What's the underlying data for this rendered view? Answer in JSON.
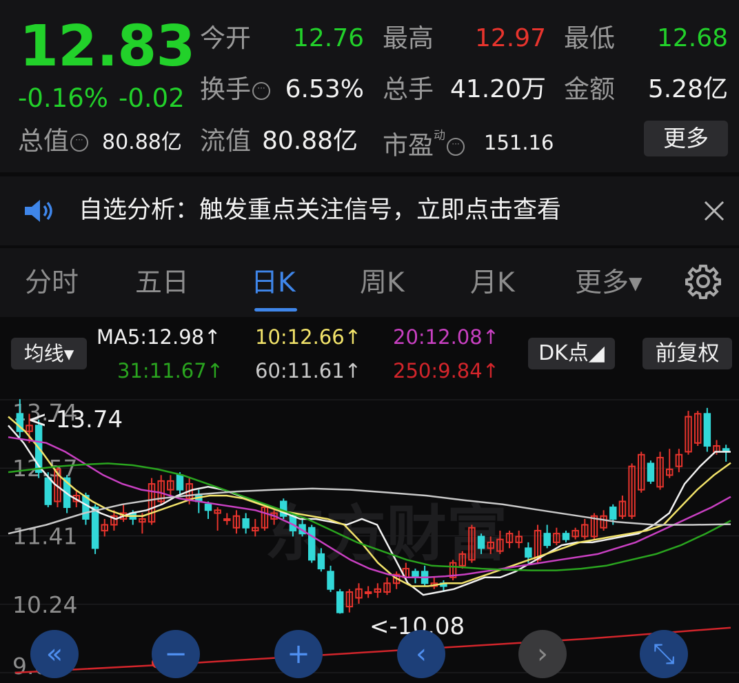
{
  "quote": {
    "price": "12.83",
    "change_pct": "-0.16%",
    "change_abs": "-0.02",
    "fields": {
      "open_label": "今开",
      "open": "12.76",
      "high_label": "最高",
      "high": "12.97",
      "low_label": "最低",
      "low": "12.68",
      "turnover_label": "换手",
      "turnover": "6.53%",
      "volume_label": "总手",
      "volume": "41.20万",
      "amount_label": "金额",
      "amount": "5.28亿",
      "mktcap_label": "总值",
      "mktcap": "80.88亿",
      "float_label": "流值",
      "float": "80.88亿",
      "pe_label": "市盈",
      "pe_sup": "动",
      "pe": "151.16"
    },
    "more_label": "更多",
    "colors": {
      "up": "#e8342d",
      "down": "#22d12a",
      "accent": "#3f86ea"
    }
  },
  "notice": {
    "icon": "speaker-icon",
    "text": "自选分析：触发重点关注信号，立即点击查看",
    "close_icon": "close-icon"
  },
  "tabs": {
    "items": [
      "分时",
      "五日",
      "日K",
      "周K",
      "月K",
      "更多▾"
    ],
    "active": "日K",
    "settings_icon": "gear-icon"
  },
  "indicators": {
    "ma_selector": "均线▾",
    "ma5": "MA5:12.98↑",
    "ma10": "10:12.66↑",
    "ma20": "20:12.08↑",
    "ma31": "31:11.67↑",
    "ma60": "60:11.61↑",
    "ma250": "250:9.84↑",
    "dk_label": "DK点◢",
    "adjust_label": "前复权"
  },
  "chart_data": {
    "type": "candlestick",
    "y_ticks": [
      "13.74",
      "12.57",
      "11.41",
      "10.24",
      "9.07"
    ],
    "ylim": [
      9.07,
      13.74
    ],
    "max_label": "<-13.74",
    "min_label": "<-10.08",
    "watermark": "东方财富",
    "candles": [
      [
        13.5,
        13.2,
        13.75,
        13.1
      ],
      [
        13.2,
        13.3,
        13.5,
        13.0
      ],
      [
        13.3,
        12.5,
        13.4,
        12.4
      ],
      [
        12.4,
        11.95,
        12.5,
        11.9
      ],
      [
        12.0,
        12.55,
        12.6,
        11.9
      ],
      [
        12.4,
        11.9,
        12.45,
        11.8
      ],
      [
        12.0,
        12.1,
        12.2,
        11.9
      ],
      [
        12.1,
        11.7,
        12.15,
        11.6
      ],
      [
        11.9,
        11.2,
        11.95,
        11.1
      ],
      [
        11.5,
        11.6,
        11.7,
        11.4
      ],
      [
        11.6,
        11.75,
        11.85,
        11.5
      ],
      [
        11.7,
        11.8,
        11.95,
        11.65
      ],
      [
        11.8,
        11.7,
        11.85,
        11.6
      ],
      [
        11.65,
        11.7,
        11.8,
        11.45
      ],
      [
        11.65,
        12.3,
        12.4,
        11.6
      ],
      [
        12.0,
        12.35,
        12.45,
        11.95
      ],
      [
        12.2,
        12.35,
        12.45,
        12.1
      ],
      [
        12.45,
        12.2,
        12.5,
        12.1
      ],
      [
        12.05,
        12.3,
        12.4,
        11.95
      ],
      [
        12.1,
        12.0,
        12.2,
        11.8
      ],
      [
        11.95,
        11.85,
        12.0,
        11.7
      ],
      [
        11.8,
        11.85,
        11.9,
        11.5
      ],
      [
        11.7,
        11.7,
        11.8,
        11.6
      ],
      [
        11.55,
        11.75,
        11.85,
        11.45
      ],
      [
        11.7,
        11.55,
        11.8,
        11.45
      ],
      [
        11.5,
        11.55,
        11.7,
        11.4
      ],
      [
        11.55,
        11.9,
        11.95,
        11.5
      ],
      [
        11.7,
        11.8,
        11.85,
        11.6
      ],
      [
        12.0,
        11.75,
        12.05,
        11.7
      ],
      [
        11.75,
        11.5,
        11.8,
        11.4
      ],
      [
        11.6,
        11.45,
        11.7,
        11.4
      ],
      [
        11.55,
        11.0,
        11.6,
        10.95
      ],
      [
        11.1,
        10.85,
        11.2,
        10.8
      ],
      [
        10.8,
        10.5,
        10.9,
        10.45
      ],
      [
        10.45,
        10.1,
        10.5,
        10.08
      ],
      [
        10.2,
        10.45,
        10.5,
        10.1
      ],
      [
        10.35,
        10.5,
        10.6,
        10.25
      ],
      [
        10.45,
        10.45,
        10.55,
        10.35
      ],
      [
        10.45,
        10.5,
        10.6,
        10.35
      ],
      [
        10.45,
        10.6,
        10.7,
        10.4
      ],
      [
        10.6,
        10.75,
        10.8,
        10.5
      ],
      [
        10.7,
        10.85,
        10.95,
        10.65
      ],
      [
        10.8,
        10.7,
        10.85,
        10.6
      ],
      [
        10.8,
        10.6,
        10.9,
        10.55
      ],
      [
        10.55,
        10.6,
        10.7,
        10.5
      ],
      [
        10.6,
        10.55,
        10.65,
        10.45
      ],
      [
        10.7,
        10.95,
        11.0,
        10.65
      ],
      [
        10.9,
        11.1,
        11.15,
        10.85
      ],
      [
        11.0,
        11.55,
        11.6,
        10.95
      ],
      [
        11.4,
        11.2,
        11.45,
        11.1
      ],
      [
        11.2,
        11.3,
        11.4,
        11.1
      ],
      [
        11.15,
        11.35,
        11.5,
        11.1
      ],
      [
        11.3,
        11.45,
        11.5,
        11.2
      ],
      [
        11.3,
        11.4,
        11.5,
        11.2
      ],
      [
        11.2,
        11.05,
        11.3,
        10.95
      ],
      [
        11.0,
        11.5,
        11.6,
        10.95
      ],
      [
        11.45,
        11.25,
        11.6,
        11.2
      ],
      [
        11.3,
        11.45,
        11.55,
        11.25
      ],
      [
        11.45,
        11.35,
        11.5,
        11.3
      ],
      [
        11.4,
        11.5,
        11.55,
        11.35
      ],
      [
        11.4,
        11.6,
        11.7,
        11.35
      ],
      [
        11.4,
        11.75,
        11.8,
        11.35
      ],
      [
        11.55,
        11.75,
        11.85,
        11.5
      ],
      [
        11.9,
        11.7,
        11.95,
        11.6
      ],
      [
        11.75,
        12.0,
        12.1,
        11.7
      ],
      [
        11.75,
        12.6,
        12.65,
        11.7
      ],
      [
        12.2,
        12.8,
        12.85,
        12.15
      ],
      [
        12.65,
        12.35,
        12.7,
        12.3
      ],
      [
        12.25,
        12.75,
        12.85,
        12.2
      ],
      [
        12.45,
        12.55,
        12.9,
        12.4
      ],
      [
        12.6,
        12.8,
        12.9,
        12.5
      ],
      [
        12.85,
        13.45,
        13.55,
        12.8
      ],
      [
        13.0,
        13.5,
        13.55,
        12.95
      ],
      [
        13.5,
        12.95,
        13.6,
        12.85
      ],
      [
        12.85,
        12.95,
        13.05,
        12.8
      ],
      [
        12.9,
        12.85,
        12.97,
        12.68
      ]
    ],
    "ma_series": [
      {
        "name": "MA5",
        "color": "#f2f2f2",
        "values": [
          13.3,
          13.0,
          12.6,
          12.3,
          12.1,
          11.95,
          11.8,
          11.7,
          11.8,
          11.85,
          11.95,
          12.1,
          12.2,
          12.25,
          12.2,
          12.1,
          12.0,
          11.9,
          11.8,
          11.7,
          11.7,
          11.65,
          11.6,
          11.7,
          11.6,
          11.1,
          10.6,
          10.4,
          10.45,
          10.5,
          10.6,
          10.7,
          10.7,
          10.8,
          10.95,
          11.1,
          11.25,
          11.3,
          11.3,
          11.35,
          11.4,
          11.45,
          11.6,
          11.8,
          12.3,
          12.6,
          12.85,
          12.85
        ]
      },
      {
        "name": "MA10",
        "color": "#f2e36a",
        "values": [
          13.45,
          13.2,
          12.85,
          12.45,
          12.2,
          12.0,
          11.85,
          11.75,
          11.75,
          11.85,
          11.95,
          12.05,
          12.1,
          12.1,
          12.05,
          11.95,
          11.85,
          11.8,
          11.75,
          11.7,
          11.6,
          11.3,
          10.95,
          10.7,
          10.55,
          10.55,
          10.6,
          10.6,
          10.7,
          10.8,
          10.9,
          11.0,
          11.1,
          11.2,
          11.3,
          11.35,
          11.4,
          11.45,
          11.5,
          11.6,
          11.9,
          12.2,
          12.45,
          12.66
        ]
      },
      {
        "name": "MA20",
        "color": "#c940c2",
        "values": [
          13.1,
          13.05,
          13.0,
          12.85,
          12.65,
          12.45,
          12.3,
          12.2,
          12.15,
          12.05,
          12.0,
          11.95,
          11.9,
          11.85,
          11.75,
          11.6,
          11.4,
          11.2,
          11.0,
          10.85,
          10.75,
          10.7,
          10.7,
          10.72,
          10.75,
          10.8,
          10.85,
          10.9,
          10.95,
          11.0,
          11.05,
          11.1,
          11.2,
          11.3,
          11.45,
          11.6,
          11.75,
          11.9,
          12.08
        ]
      },
      {
        "name": "MA31",
        "color": "#2aa51f",
        "values": [
          12.5,
          12.55,
          12.6,
          12.63,
          12.65,
          12.62,
          12.55,
          12.45,
          12.3,
          12.15,
          12.0,
          11.85,
          11.7,
          11.5,
          11.3,
          11.15,
          11.0,
          10.9,
          10.88,
          10.85,
          10.83,
          10.82,
          10.82,
          10.85,
          10.9,
          11.0,
          11.1,
          11.25,
          11.45,
          11.67
        ]
      },
      {
        "name": "MA60",
        "color": "#c9c9c9",
        "values": [
          11.45,
          11.6,
          11.8,
          11.95,
          12.05,
          12.12,
          12.17,
          12.2,
          12.22,
          12.2,
          12.15,
          12.1,
          12.02,
          11.95,
          11.85,
          11.75,
          11.65,
          11.6,
          11.6,
          11.61
        ]
      },
      {
        "name": "MA250",
        "color": "#d3252b",
        "values": [
          9.07,
          9.2,
          9.35,
          9.5,
          9.65,
          9.84
        ]
      }
    ]
  },
  "controls": [
    {
      "name": "scroll-left-fast-button",
      "glyph": "«"
    },
    {
      "name": "zoom-out-button",
      "glyph": "−"
    },
    {
      "name": "zoom-in-button",
      "glyph": "+"
    },
    {
      "name": "prev-button",
      "glyph": "‹"
    },
    {
      "name": "next-button",
      "glyph": "›"
    },
    {
      "name": "fullscreen-button",
      "glyph": "⤡"
    }
  ]
}
